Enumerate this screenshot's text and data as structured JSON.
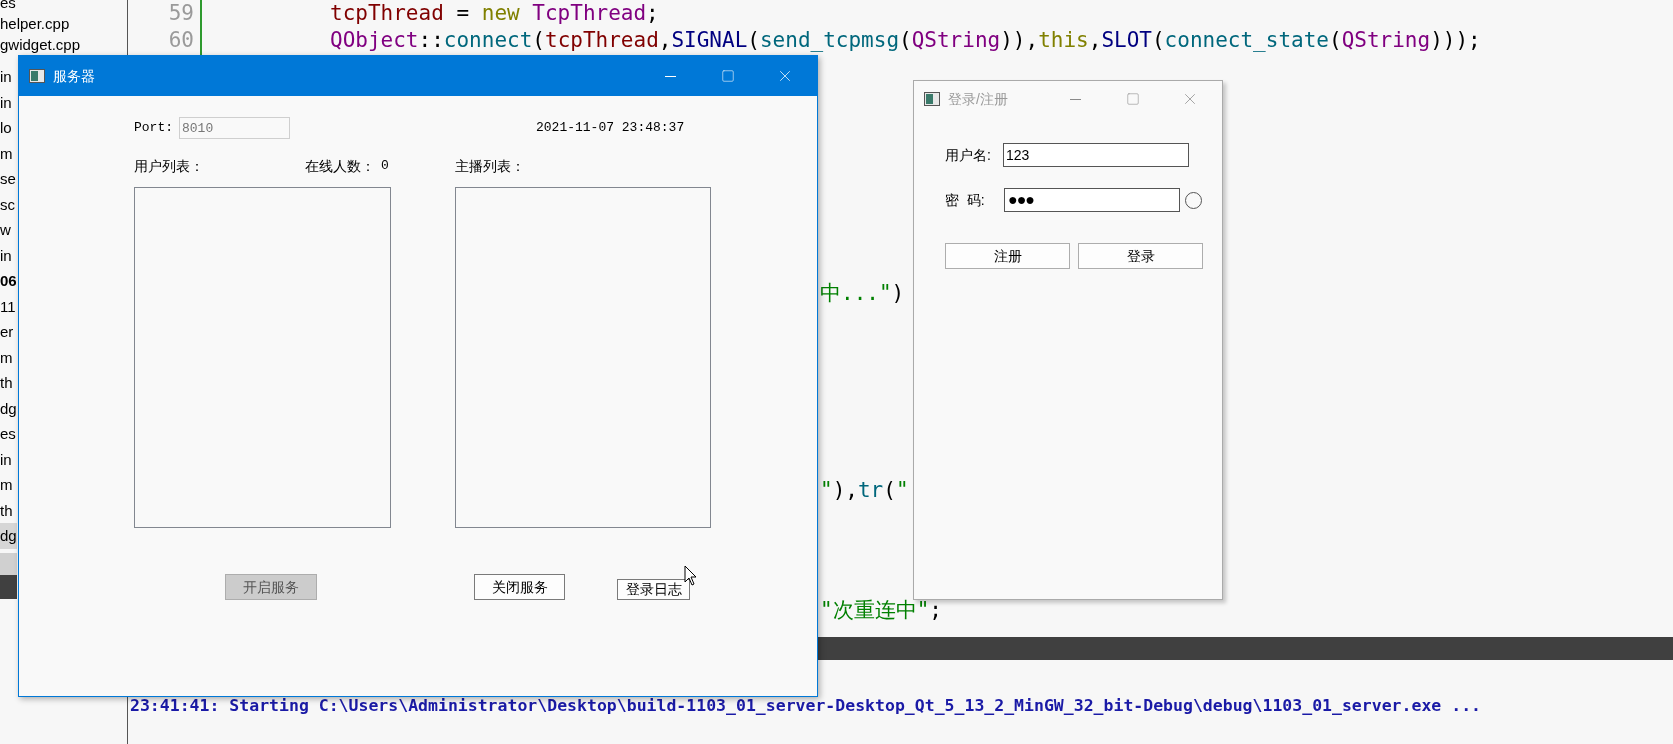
{
  "ide": {
    "file_list": [
      {
        "label": "es",
        "bold": false,
        "selected": false
      },
      {
        "label": "helper.cpp",
        "bold": false,
        "selected": false
      },
      {
        "label": "gwidget.cpp",
        "bold": false,
        "selected": false
      },
      {
        "label": "in",
        "bold": false,
        "selected": false
      },
      {
        "label": "in",
        "bold": false,
        "selected": false
      },
      {
        "label": "lo",
        "bold": false,
        "selected": false
      },
      {
        "label": "m",
        "bold": false,
        "selected": false
      },
      {
        "label": "se",
        "bold": false,
        "selected": false
      },
      {
        "label": "sc",
        "bold": false,
        "selected": false
      },
      {
        "label": "w",
        "bold": false,
        "selected": false
      },
      {
        "label": "in",
        "bold": false,
        "selected": false
      },
      {
        "label": "06",
        "bold": true,
        "selected": false
      },
      {
        "label": "11",
        "bold": false,
        "selected": false
      },
      {
        "label": "er",
        "bold": false,
        "selected": false
      },
      {
        "label": "m",
        "bold": false,
        "selected": false
      },
      {
        "label": "th",
        "bold": false,
        "selected": false
      },
      {
        "label": "dg",
        "bold": false,
        "selected": false
      },
      {
        "label": "es",
        "bold": false,
        "selected": false
      },
      {
        "label": "in",
        "bold": false,
        "selected": false
      },
      {
        "label": "m",
        "bold": false,
        "selected": false
      },
      {
        "label": "th",
        "bold": false,
        "selected": false
      },
      {
        "label": "dg",
        "bold": false,
        "selected": true
      }
    ],
    "code_lines": [
      {
        "number": "59",
        "segments": [
          {
            "kind": "var",
            "text": "tcpThread"
          },
          {
            "kind": "plain",
            "text": " = "
          },
          {
            "kind": "keyword",
            "text": "new"
          },
          {
            "kind": "type",
            "text": " TcpThread"
          },
          {
            "kind": "plain",
            "text": ";"
          }
        ]
      },
      {
        "number": "60",
        "segments": [
          {
            "kind": "type",
            "text": "QObject"
          },
          {
            "kind": "plain",
            "text": "::"
          },
          {
            "kind": "func",
            "text": "connect"
          },
          {
            "kind": "plain",
            "text": "("
          },
          {
            "kind": "var",
            "text": "tcpThread"
          },
          {
            "kind": "plain",
            "text": ","
          },
          {
            "kind": "macro",
            "text": "SIGNAL"
          },
          {
            "kind": "plain",
            "text": "("
          },
          {
            "kind": "func",
            "text": "send_tcpmsg"
          },
          {
            "kind": "plain",
            "text": "("
          },
          {
            "kind": "type",
            "text": "QString"
          },
          {
            "kind": "plain",
            "text": ")),"
          },
          {
            "kind": "keyword",
            "text": "this"
          },
          {
            "kind": "plain",
            "text": ","
          },
          {
            "kind": "macro",
            "text": "SLOT"
          },
          {
            "kind": "plain",
            "text": "("
          },
          {
            "kind": "func",
            "text": "connect_state"
          },
          {
            "kind": "plain",
            "text": "("
          },
          {
            "kind": "type",
            "text": "QString"
          },
          {
            "kind": "plain",
            "text": ")));"
          }
        ]
      }
    ],
    "code_fragments": [
      [
        {
          "kind": "string",
          "text": "中...\""
        },
        {
          "kind": "plain",
          "text": ")"
        }
      ],
      [
        {
          "kind": "string",
          "text": "\""
        },
        {
          "kind": "plain",
          "text": "),"
        },
        {
          "kind": "func",
          "text": "tr"
        },
        {
          "kind": "plain",
          "text": "("
        },
        {
          "kind": "string",
          "text": "\""
        }
      ],
      [
        {
          "kind": "string",
          "text": "\"次重连中\""
        },
        {
          "kind": "plain",
          "text": ";"
        }
      ]
    ],
    "output": "23:41:41: Starting C:\\Users\\Administrator\\Desktop\\build-1103_01_server-Desktop_Qt_5_13_2_MinGW_32_bit-Debug\\debug\\1103_01_server.exe ..."
  },
  "server_window": {
    "title": "服务器",
    "active": true,
    "port": {
      "label": "Port:",
      "value": "8010",
      "disabled": true
    },
    "datetime": "2021-11-07 23:48:37",
    "user_list_label": "用户列表：",
    "online_label": "在线人数：",
    "online_count": "0",
    "host_list_label": "主播列表：",
    "buttons": [
      {
        "label": "开启服务",
        "disabled": true
      },
      {
        "label": "关闭服务",
        "disabled": false
      },
      {
        "label": "登录日志",
        "disabled": false
      }
    ]
  },
  "login_window": {
    "title": "登录/注册",
    "active": false,
    "username": {
      "label": "用户名:",
      "value": "123"
    },
    "password": {
      "label": "密  码:",
      "value": "●●●"
    },
    "password_toggle": {
      "checked": false
    },
    "buttons": [
      {
        "label": "注册"
      },
      {
        "label": "登录"
      }
    ]
  }
}
